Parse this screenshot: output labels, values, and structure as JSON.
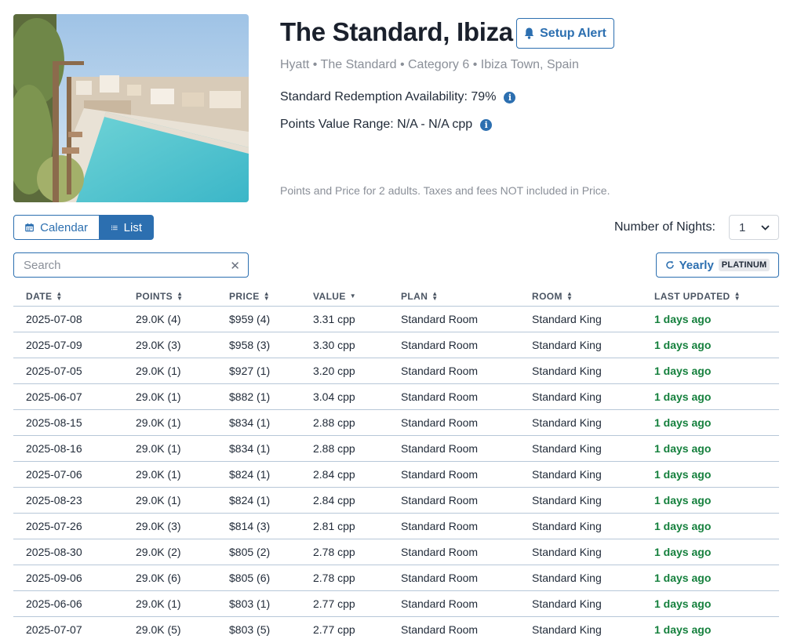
{
  "hotel": {
    "name": "The Standard, Ibiza",
    "subtitle": "Hyatt • The Standard • Category 6 • Ibiza Town, Spain",
    "availability_label": "Standard Redemption Availability: 79%",
    "points_value_label": "Points Value Range: N/A - N/A cpp",
    "note": "Points and Price for 2 adults.  Taxes and fees NOT included in Price.",
    "image_icon": "hotel-pool-photo"
  },
  "actions": {
    "setup_alert": "Setup Alert",
    "calendar": "Calendar",
    "list": "List",
    "nights_label": "Number of Nights:",
    "nights_value": "1",
    "search_placeholder": "Search",
    "yearly": "Yearly",
    "yearly_badge": "PLATINUM"
  },
  "colors": {
    "accent": "#2c6fb0",
    "updated_green": "#15803d"
  },
  "table": {
    "headers": [
      "DATE",
      "POINTS",
      "PRICE",
      "VALUE",
      "PLAN",
      "ROOM",
      "LAST UPDATED"
    ],
    "rows": [
      [
        "2025-07-08",
        "29.0K (4)",
        "$959 (4)",
        "3.31 cpp",
        "Standard Room",
        "Standard King",
        "1 days ago"
      ],
      [
        "2025-07-09",
        "29.0K (3)",
        "$958 (3)",
        "3.30 cpp",
        "Standard Room",
        "Standard King",
        "1 days ago"
      ],
      [
        "2025-07-05",
        "29.0K (1)",
        "$927 (1)",
        "3.20 cpp",
        "Standard Room",
        "Standard King",
        "1 days ago"
      ],
      [
        "2025-06-07",
        "29.0K (1)",
        "$882 (1)",
        "3.04 cpp",
        "Standard Room",
        "Standard King",
        "1 days ago"
      ],
      [
        "2025-08-15",
        "29.0K (1)",
        "$834 (1)",
        "2.88 cpp",
        "Standard Room",
        "Standard King",
        "1 days ago"
      ],
      [
        "2025-08-16",
        "29.0K (1)",
        "$834 (1)",
        "2.88 cpp",
        "Standard Room",
        "Standard King",
        "1 days ago"
      ],
      [
        "2025-07-06",
        "29.0K (1)",
        "$824 (1)",
        "2.84 cpp",
        "Standard Room",
        "Standard King",
        "1 days ago"
      ],
      [
        "2025-08-23",
        "29.0K (1)",
        "$824 (1)",
        "2.84 cpp",
        "Standard Room",
        "Standard King",
        "1 days ago"
      ],
      [
        "2025-07-26",
        "29.0K (3)",
        "$814 (3)",
        "2.81 cpp",
        "Standard Room",
        "Standard King",
        "1 days ago"
      ],
      [
        "2025-08-30",
        "29.0K (2)",
        "$805 (2)",
        "2.78 cpp",
        "Standard Room",
        "Standard King",
        "1 days ago"
      ],
      [
        "2025-09-06",
        "29.0K (6)",
        "$805 (6)",
        "2.78 cpp",
        "Standard Room",
        "Standard King",
        "1 days ago"
      ],
      [
        "2025-06-06",
        "29.0K (1)",
        "$803 (1)",
        "2.77 cpp",
        "Standard Room",
        "Standard King",
        "1 days ago"
      ],
      [
        "2025-07-07",
        "29.0K (5)",
        "$803 (5)",
        "2.77 cpp",
        "Standard Room",
        "Standard King",
        "1 days ago"
      ]
    ]
  }
}
